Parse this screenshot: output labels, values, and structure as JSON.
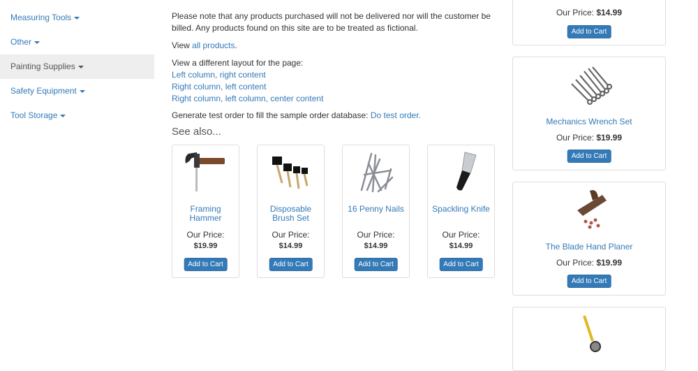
{
  "sidebar": {
    "items": [
      {
        "label": "Measuring Tools"
      },
      {
        "label": "Other"
      },
      {
        "label": "Painting Supplies"
      },
      {
        "label": "Safety Equipment"
      },
      {
        "label": "Tool Storage"
      }
    ]
  },
  "main": {
    "notice": "Please note that any products purchased will not be delivered nor will the customer be billed. Any products found on this site are to be treated as fictional.",
    "view_prefix": "View",
    "view_link": "all products",
    "layout_heading": "View a different layout for the page:",
    "layouts": [
      "Left column, right content",
      "Right column, left content",
      "Right column, left column, center content"
    ],
    "test_prefix": "Generate test order to fill the sample order database:",
    "test_link": "Do test order.",
    "see_also": "See also..."
  },
  "see_also_products": [
    {
      "name": "Framing Hammer",
      "price_label": "Our Price:",
      "price": "$19.99",
      "button": "Add to Cart",
      "icon": "hammer-icon"
    },
    {
      "name": "Disposable Brush Set",
      "price_label": "Our Price:",
      "price": "$14.99",
      "button": "Add to Cart",
      "icon": "brush-set-icon"
    },
    {
      "name": "16 Penny Nails",
      "price_label": "Our Price:",
      "price": "$14.99",
      "button": "Add to Cart",
      "icon": "nails-icon"
    },
    {
      "name": "Spackling Knife",
      "price_label": "Our Price:",
      "price": "$14.99",
      "button": "Add to Cart",
      "icon": "knife-icon"
    }
  ],
  "right_products": [
    {
      "name": "",
      "price_label": "Our Price:",
      "price": "$14.99",
      "button": "Add to Cart"
    },
    {
      "name": "Mechanics Wrench Set",
      "price_label": "Our Price:",
      "price": "$19.99",
      "button": "Add to Cart",
      "icon": "wrench-set-icon"
    },
    {
      "name": "The Blade Hand Planer",
      "price_label": "Our Price:",
      "price": "$19.99",
      "button": "Add to Cart",
      "icon": "hand-planer-icon"
    },
    {
      "name": "",
      "icon": "tape-measure-icon"
    }
  ]
}
